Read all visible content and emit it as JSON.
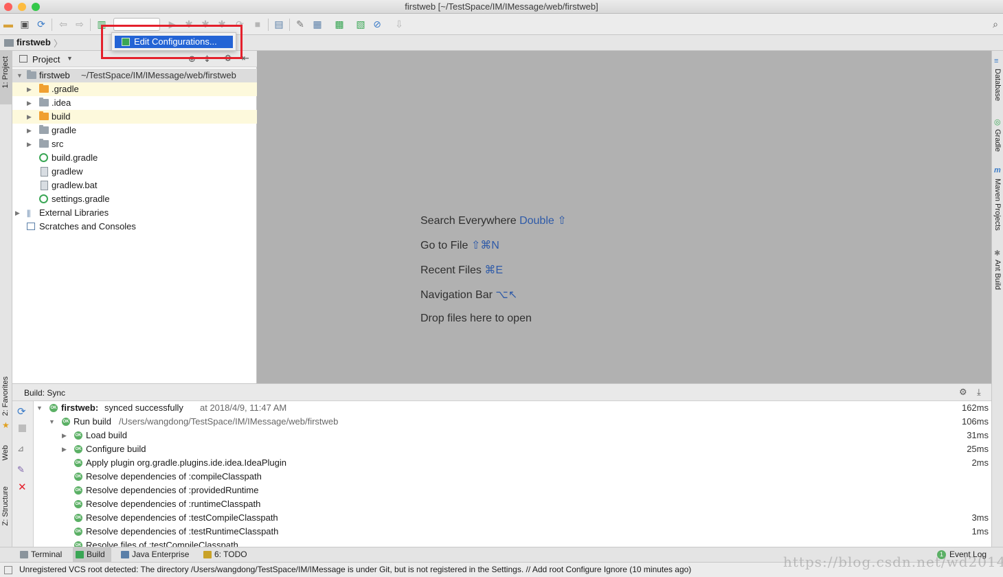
{
  "window": {
    "title": "firstweb [~/TestSpace/IM/IMessage/web/firstweb]"
  },
  "navbar": {
    "project": "firstweb"
  },
  "popup": {
    "item": "Edit Configurations..."
  },
  "left_strip": {
    "project": "1: Project",
    "favorites": "2: Favorites",
    "web": "Web",
    "structure": "Z: Structure"
  },
  "right_strip": {
    "database": "Database",
    "gradle": "Gradle",
    "maven": "Maven Projects",
    "ant": "Ant Build"
  },
  "project_panel": {
    "view": "Project",
    "root_name": "firstweb",
    "root_path": "~/TestSpace/IM/IMessage/web/firstweb",
    "items": [
      {
        "label": ".gradle"
      },
      {
        "label": ".idea"
      },
      {
        "label": "build"
      },
      {
        "label": "gradle"
      },
      {
        "label": "src"
      },
      {
        "label": "build.gradle"
      },
      {
        "label": "gradlew"
      },
      {
        "label": "gradlew.bat"
      },
      {
        "label": "settings.gradle"
      },
      {
        "label": "External Libraries"
      },
      {
        "label": "Scratches and Consoles"
      }
    ]
  },
  "editor": {
    "hints": [
      {
        "text": "Search Everywhere",
        "key": "Double ⇧"
      },
      {
        "text": "Go to File",
        "key": "⇧⌘N"
      },
      {
        "text": "Recent Files",
        "key": "⌘E"
      },
      {
        "text": "Navigation Bar",
        "key": "⌥↖"
      },
      {
        "text": "Drop files here to open",
        "key": ""
      }
    ]
  },
  "build": {
    "header": "Build: Sync",
    "rows": [
      {
        "name": "firstweb:",
        "text": "synced successfully",
        "extra": "at 2018/4/9, 11:47 AM",
        "dur": "162ms"
      },
      {
        "text": "Run build",
        "extra": "/Users/wangdong/TestSpace/IM/IMessage/web/firstweb",
        "dur": "106ms"
      },
      {
        "text": "Load build",
        "dur": "31ms"
      },
      {
        "text": "Configure build",
        "dur": "25ms"
      },
      {
        "text": "Apply plugin org.gradle.plugins.ide.idea.IdeaPlugin",
        "dur": "2ms"
      },
      {
        "text": "Resolve dependencies of :compileClasspath",
        "dur": ""
      },
      {
        "text": "Resolve dependencies of :providedRuntime",
        "dur": ""
      },
      {
        "text": "Resolve dependencies of :runtimeClasspath",
        "dur": ""
      },
      {
        "text": "Resolve dependencies of :testCompileClasspath",
        "dur": "3ms"
      },
      {
        "text": "Resolve dependencies of :testRuntimeClasspath",
        "dur": "1ms"
      },
      {
        "text": "Resolve files of :testCompileClasspath",
        "dur": ""
      }
    ]
  },
  "bottom_tabs": {
    "terminal": "Terminal",
    "build": "Build",
    "java_enterprise": "Java Enterprise",
    "todo": "6: TODO",
    "event_log": "Event Log",
    "event_count": "1"
  },
  "status": {
    "message": "Unregistered VCS root detected: The directory /Users/wangdong/TestSpace/IM/IMessage is under Git, but is not registered in the Settings. // Add root  Configure  Ignore (10 minutes ago)"
  },
  "watermark": "https://blog.csdn.net/wd2014610",
  "colors": {
    "accent": "#2464d5",
    "highlight_box": "#e4202c",
    "ok_green": "#5bb065",
    "editor_bg": "#b1b1b1"
  }
}
